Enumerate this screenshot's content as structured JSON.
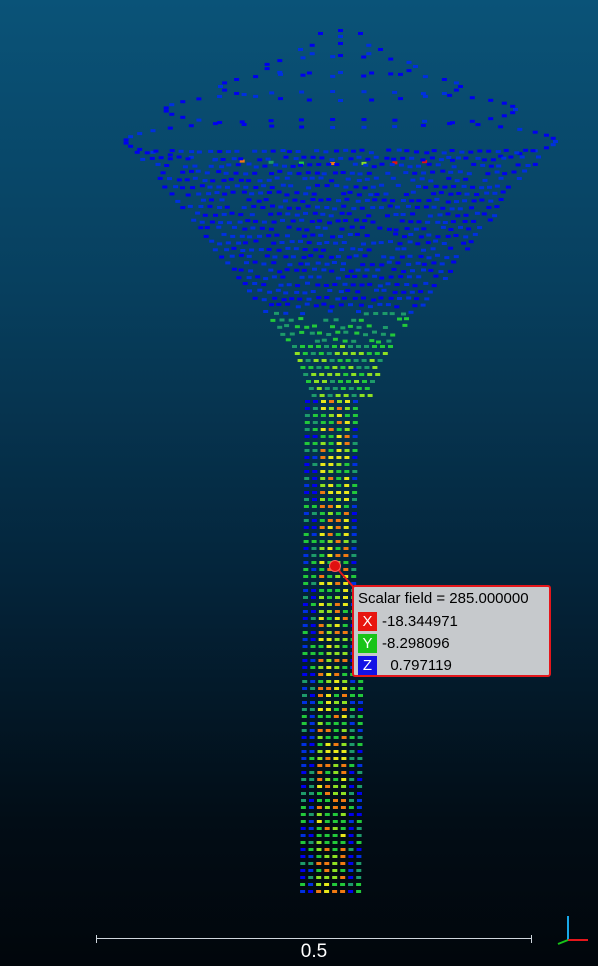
{
  "viewer": {
    "background_top": "#0a5378",
    "background_bottom": "#01060b"
  },
  "point_info": {
    "title": "Scalar field = 285.000000",
    "accent_color": "#e4161b",
    "coords": [
      {
        "axis": "X",
        "value": "-18.344971",
        "color": "#e8150f"
      },
      {
        "axis": "Y",
        "value": "-8.298096",
        "color": "#18c418"
      },
      {
        "axis": "Z",
        "value": "  0.797119",
        "color": "#1212e6"
      }
    ]
  },
  "scale_bar": {
    "label": "0.5"
  },
  "axis_triad": {
    "icon": "xyz-axis-icon",
    "x_color": "#e4161b",
    "y_color": "#18c418",
    "z_color": "#18a8e8"
  },
  "colormap": [
    "#0000ee",
    "#0030e0",
    "#1d9a6a",
    "#22c83a",
    "#8ee022",
    "#e8e81a",
    "#f07a12",
    "#e81010"
  ]
}
